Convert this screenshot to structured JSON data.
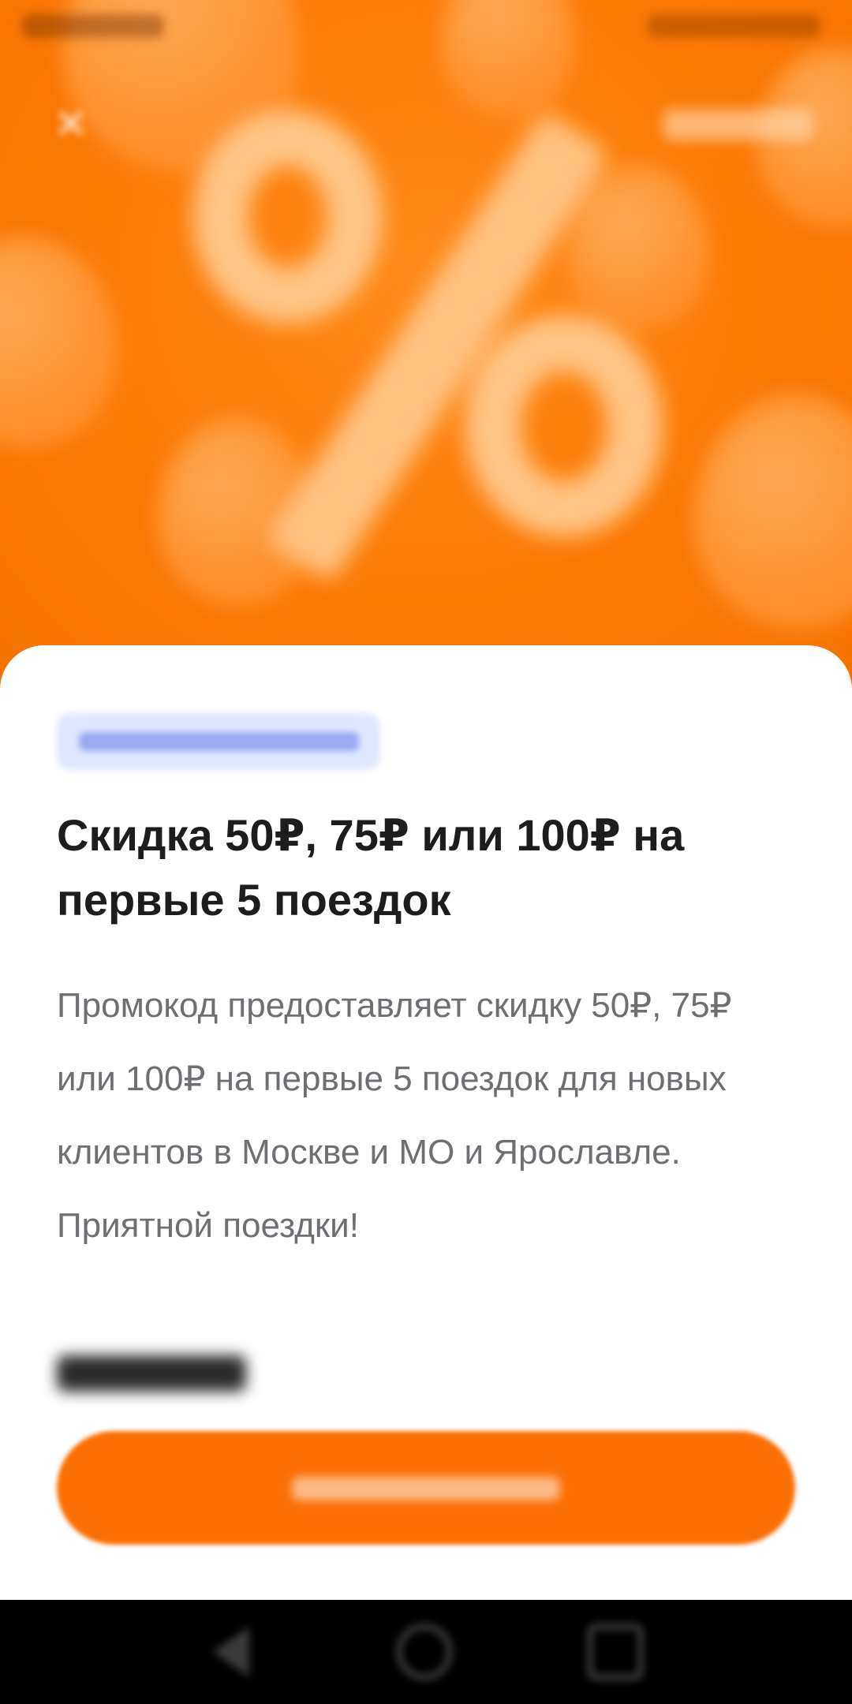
{
  "status_bar": {
    "time": "",
    "indicators": ""
  },
  "hero": {
    "close_icon": "close-icon",
    "top_right_link": "",
    "illustration": "percent-sign-with-balloons",
    "colors": {
      "background": "#fb7a06",
      "accent": "#ffc687"
    }
  },
  "card": {
    "tag": "",
    "title": "Скидка 50₽, 75₽ или 100₽ на первые 5 поездок",
    "description": "Промокод предоставляет скидку 50₽, 75₽ или 100₽ на первые 5 поездок для новых клиентов в Москве и МО и Ярославле. Приятной поездки!",
    "conditions_label": "",
    "activate_button_label": "",
    "colors": {
      "button": "#fb7005",
      "tag": "#dfe6ff"
    }
  },
  "nav_bar": {
    "icons": [
      "back-icon",
      "home-icon",
      "recent-apps-icon"
    ]
  }
}
